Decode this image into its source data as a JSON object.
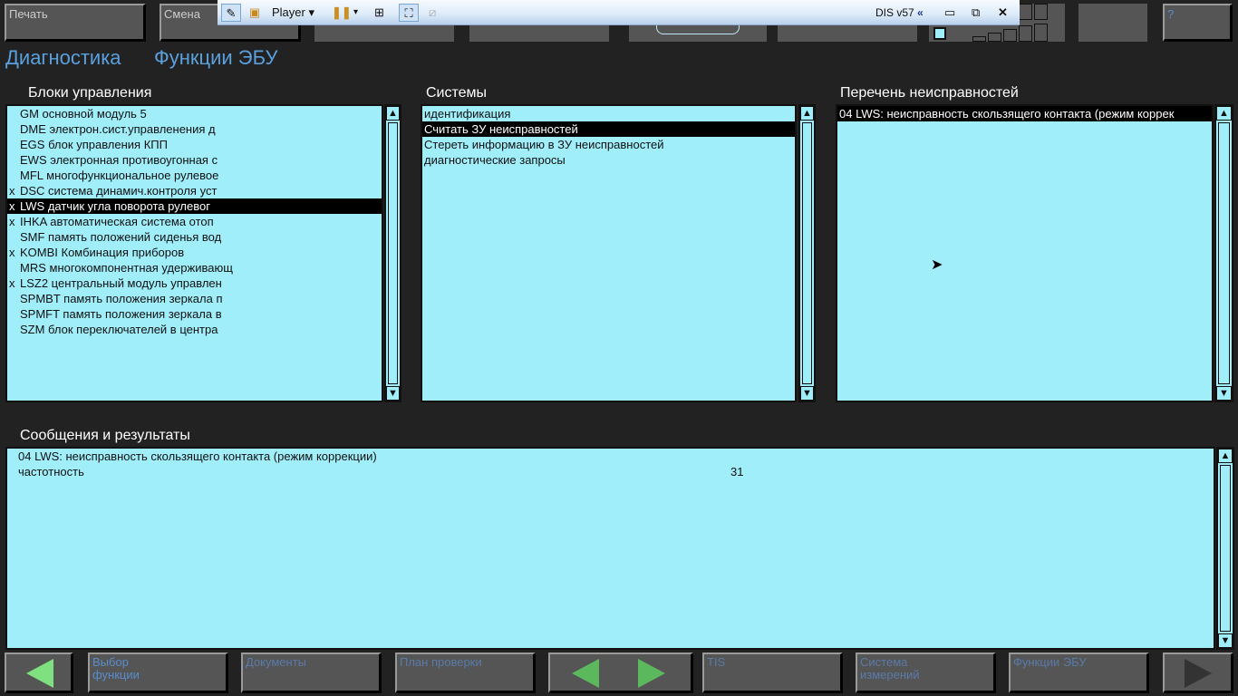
{
  "top_buttons": {
    "print": "Печать",
    "change": "Смена",
    "help": "?"
  },
  "toolbar": {
    "player_label": "Player",
    "app_version": "DIS v57"
  },
  "breadcrumb": {
    "root": "Диагностика",
    "current": "Функции ЭБУ"
  },
  "control_units": {
    "header": "Блоки управления",
    "items": [
      {
        "mark": "",
        "label": "GM основной модуль 5"
      },
      {
        "mark": "",
        "label": "DME электрон.сист.управленения д"
      },
      {
        "mark": "",
        "label": "EGS блок управления КПП"
      },
      {
        "mark": "",
        "label": "EWS электронная противоугонная с"
      },
      {
        "mark": "",
        "label": "MFL многофункциональное рулевое"
      },
      {
        "mark": "x",
        "label": "DSC система динамич.контроля уст"
      },
      {
        "mark": "x",
        "label": "LWS датчик угла поворота рулевог",
        "selected": true
      },
      {
        "mark": "x",
        "label": "IHKA автоматическая система отоп"
      },
      {
        "mark": "",
        "label": "SMF память положений сиденья вод"
      },
      {
        "mark": "x",
        "label": "KOMBI Комбинация приборов"
      },
      {
        "mark": "",
        "label": "MRS многокомпонентная удерживающ"
      },
      {
        "mark": "x",
        "label": "LSZ2 центральный модуль управлен"
      },
      {
        "mark": "",
        "label": "SPMBT память положения зеркала п"
      },
      {
        "mark": "",
        "label": "SPMFT память положения зеркала в"
      },
      {
        "mark": "",
        "label": "SZM блок переключателей в центра"
      }
    ]
  },
  "systems": {
    "header": "Системы",
    "items": [
      {
        "label": "идентификация"
      },
      {
        "label": "Считать ЗУ неисправностей",
        "selected": true
      },
      {
        "label": "Стереть информацию в ЗУ неисправностей"
      },
      {
        "label": "диагностические запросы"
      }
    ]
  },
  "faults": {
    "header": "Перечень неисправностей",
    "items": [
      {
        "label": "04 LWS: неисправность скользящего контакта (режим коррек",
        "selected": true
      }
    ]
  },
  "messages": {
    "header": "Сообщения и результаты",
    "line1": "04 LWS: неисправность скользящего контакта (режим коррекции)",
    "freq_label": "частотность",
    "freq_value": "31"
  },
  "bottom_nav": {
    "select_function": "Выбор функции",
    "documents": "Документы",
    "test_plan": "План проверки",
    "tis": "TIS",
    "measurement": "Система измерений",
    "ecu_functions": "Функции ЭБУ"
  }
}
